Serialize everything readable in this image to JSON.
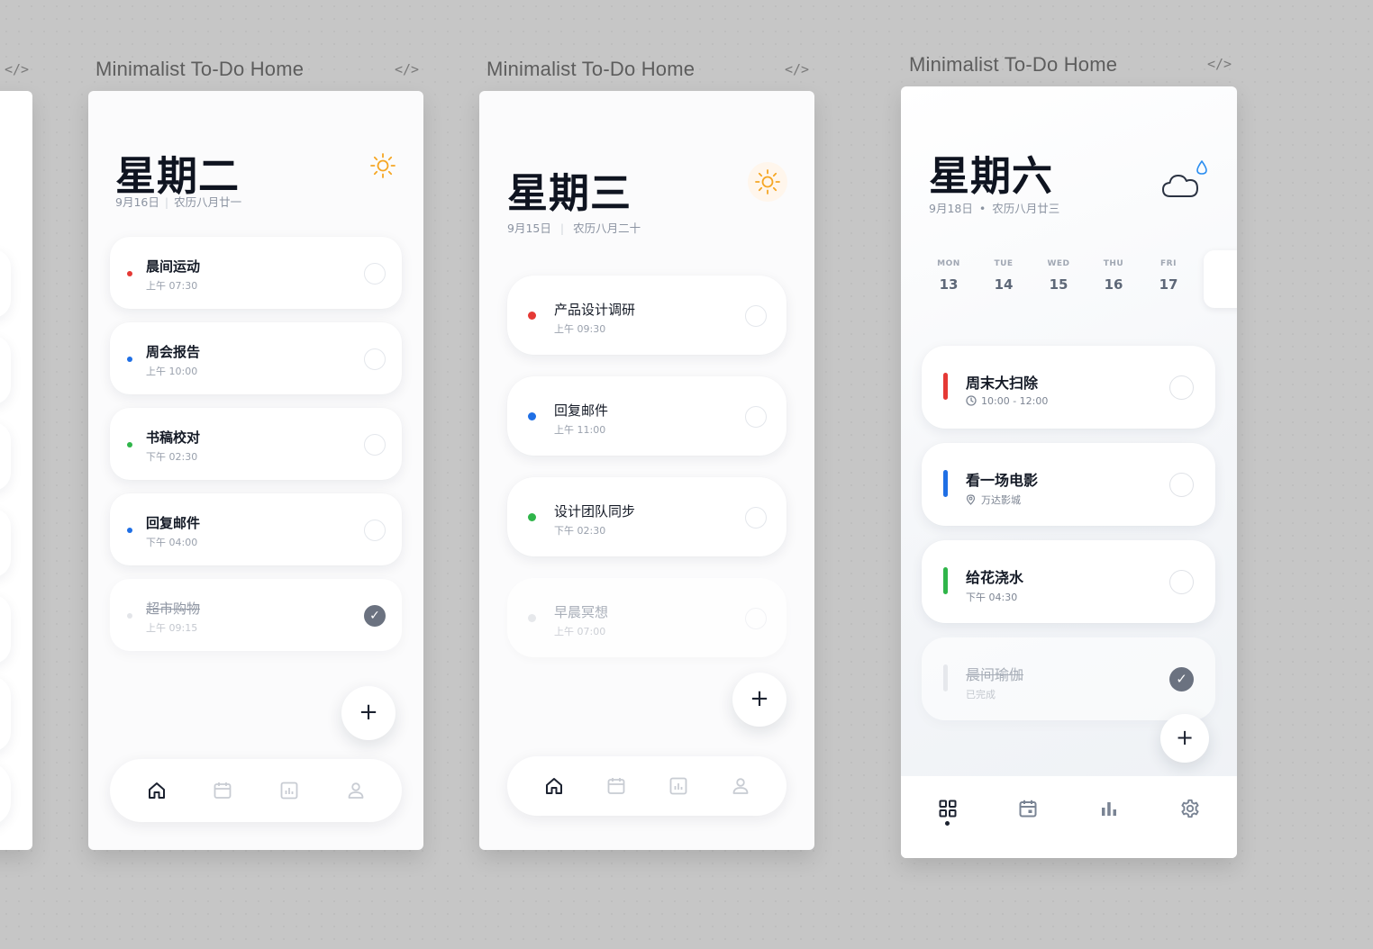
{
  "frames": {
    "title": "Minimalist To-Do Home",
    "code_icon": "</>"
  },
  "frame1": {
    "day": "星期二",
    "date": "9月16日",
    "lunar": "农历八月廿一",
    "weather_icon": "sun-icon",
    "tasks": [
      {
        "name": "晨间运动",
        "time": "上午 07:30",
        "color": "#e53935",
        "done": false
      },
      {
        "name": "周会报告",
        "time": "上午 10:00",
        "color": "#1f6fe5",
        "done": false
      },
      {
        "name": "书稿校对",
        "time": "下午 02:30",
        "color": "#2fb54a",
        "done": false
      },
      {
        "name": "回复邮件",
        "time": "下午 04:00",
        "color": "#1f6fe5",
        "done": false
      },
      {
        "name": "超市购物",
        "time": "上午 09:15",
        "color": "#d9dce1",
        "done": true
      }
    ],
    "fab": "+",
    "nav": [
      "home-icon",
      "calendar-icon",
      "chart-icon",
      "profile-icon"
    ]
  },
  "frame2": {
    "day": "星期三",
    "date": "9月15日",
    "lunar": "农历八月二十",
    "weather_icon": "sun-icon",
    "tasks": [
      {
        "name": "产品设计调研",
        "time": "上午 09:30",
        "color": "#e53935",
        "done": false
      },
      {
        "name": "回复邮件",
        "time": "上午 11:00",
        "color": "#1f6fe5",
        "done": false
      },
      {
        "name": "设计团队同步",
        "time": "下午 02:30",
        "color": "#2fb54a",
        "done": false
      },
      {
        "name": "早晨冥想",
        "time": "上午 07:00",
        "color": "#d9dce1",
        "done": true
      }
    ],
    "fab": "+",
    "nav": [
      "home-icon",
      "calendar-icon",
      "chart-icon",
      "profile-icon"
    ]
  },
  "frame3": {
    "day": "星期六",
    "date": "9月18日",
    "lunar": "农历八月廿三",
    "dot": "•",
    "weather_icon": "cloud-rain-icon",
    "week": [
      {
        "label": "MON",
        "num": "13"
      },
      {
        "label": "TUE",
        "num": "14"
      },
      {
        "label": "WED",
        "num": "15"
      },
      {
        "label": "THU",
        "num": "16"
      },
      {
        "label": "FRI",
        "num": "17"
      }
    ],
    "tasks": [
      {
        "name": "周末大扫除",
        "sub": "10:00 - 12:00",
        "sub_icon": "clock-icon",
        "color": "#e53935",
        "done": false
      },
      {
        "name": "看一场电影",
        "sub": "万达影城",
        "sub_icon": "location-icon",
        "color": "#1f6fe5",
        "done": false
      },
      {
        "name": "给花浇水",
        "sub": "下午 04:30",
        "sub_icon": "",
        "color": "#2fb54a",
        "done": false
      },
      {
        "name": "晨间瑜伽",
        "sub": "已完成",
        "sub_icon": "",
        "color": "#e3e5e9",
        "done": true
      }
    ],
    "fab": "+",
    "nav": [
      "grid-icon",
      "calendar-icon",
      "bar-chart-icon",
      "settings-icon"
    ]
  }
}
